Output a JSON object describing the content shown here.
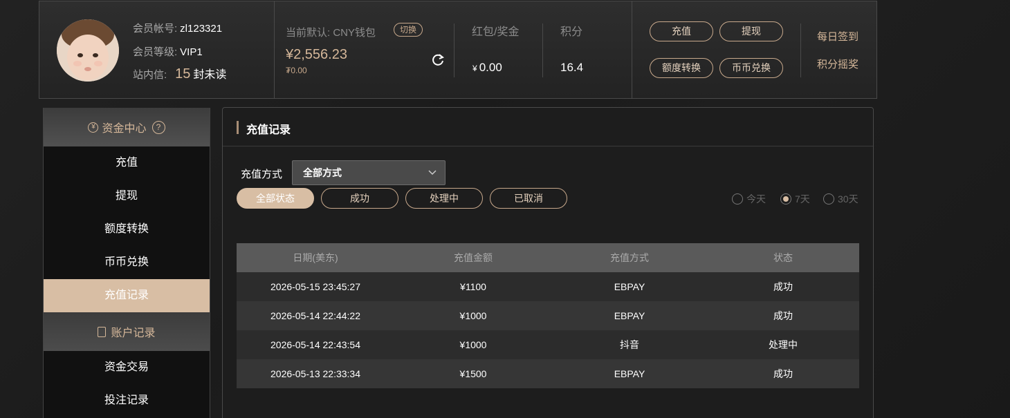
{
  "header": {
    "account_label": "会员帐号:",
    "account_value": "zl123321",
    "level_label": "会员等级:",
    "level_value": "VIP1",
    "message_label": "站内信:",
    "message_count": "15",
    "message_suffix": "封未读",
    "wallet_label": "当前默认: CNY钱包",
    "switch_label": "切换",
    "balance": "¥2,556.23",
    "sub_balance": "₮0.00",
    "bonus_label": "红包/奖金",
    "bonus_currency": "¥",
    "bonus_value": "0.00",
    "points_label": "积分",
    "points_value": "16.4",
    "btn_deposit": "充值",
    "btn_withdraw": "提现",
    "btn_transfer": "额度转换",
    "btn_coin_exchange": "币币兑换",
    "daily_signin": "每日签到",
    "points_lottery": "积分摇奖"
  },
  "sidebar": {
    "fund_center": "资金中心",
    "fund_center_help": "?",
    "items": [
      "充值",
      "提现",
      "额度转换",
      "币币兑换",
      "充值记录"
    ],
    "active_index": 4,
    "account_records": "账户记录",
    "items2": [
      "资金交易",
      "投注记录"
    ]
  },
  "main": {
    "title": "充值记录",
    "method_label": "充值方式",
    "method_selected": "全部方式",
    "status_filters": [
      "全部状态",
      "成功",
      "处理中",
      "已取消"
    ],
    "active_status": 0,
    "date_ranges": [
      "今天",
      "7天",
      "30天"
    ],
    "active_range": 1,
    "table": {
      "headers": [
        "日期(美东)",
        "充值金额",
        "充值方式",
        "状态"
      ],
      "rows": [
        [
          "2026-05-15 23:45:27",
          "¥1100",
          "EBPAY",
          "成功"
        ],
        [
          "2026-05-14 22:44:22",
          "¥1000",
          "EBPAY",
          "成功"
        ],
        [
          "2026-05-14 22:43:54",
          "¥1000",
          "抖音",
          "处理中"
        ],
        [
          "2026-05-13 22:33:34",
          "¥1500",
          "EBPAY",
          "成功"
        ]
      ]
    }
  },
  "colors": {
    "accent": "#d8bea4",
    "gold_text": "#d6b89a",
    "border": "#4a4a4a"
  }
}
